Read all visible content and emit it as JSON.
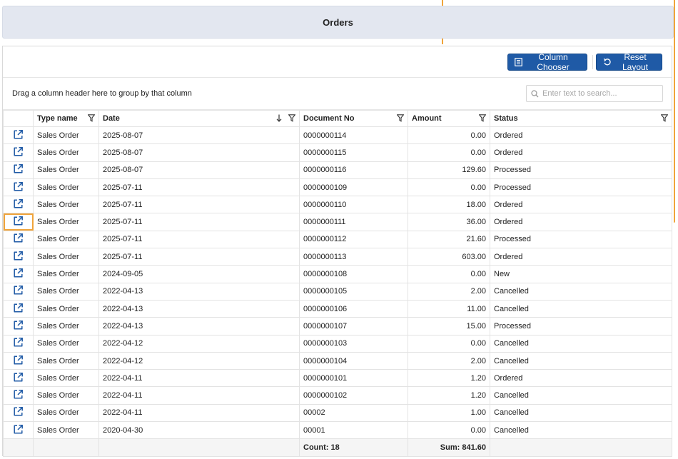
{
  "header": {
    "title": "Orders"
  },
  "toolbar": {
    "column_chooser_label": "Column Chooser",
    "reset_layout_label": "Reset Layout"
  },
  "group_panel": {
    "text": "Drag a column header here to group by that column"
  },
  "search": {
    "placeholder": "Enter text to search..."
  },
  "columns": [
    "Type name",
    "Date",
    "Document No",
    "Amount",
    "Status"
  ],
  "sort": {
    "column": "Date",
    "direction": "descending"
  },
  "rows": [
    [
      "Sales Order",
      "2025-08-07",
      "0000000114",
      "0.00",
      "Ordered"
    ],
    [
      "Sales Order",
      "2025-08-07",
      "0000000115",
      "0.00",
      "Ordered"
    ],
    [
      "Sales Order",
      "2025-08-07",
      "0000000116",
      "129.60",
      "Processed"
    ],
    [
      "Sales Order",
      "2025-07-11",
      "0000000109",
      "0.00",
      "Processed"
    ],
    [
      "Sales Order",
      "2025-07-11",
      "0000000110",
      "18.00",
      "Ordered"
    ],
    [
      "Sales Order",
      "2025-07-11",
      "0000000111",
      "36.00",
      "Ordered"
    ],
    [
      "Sales Order",
      "2025-07-11",
      "0000000112",
      "21.60",
      "Processed"
    ],
    [
      "Sales Order",
      "2025-07-11",
      "0000000113",
      "603.00",
      "Ordered"
    ],
    [
      "Sales Order",
      "2024-09-05",
      "0000000108",
      "0.00",
      "New"
    ],
    [
      "Sales Order",
      "2022-04-13",
      "0000000105",
      "2.00",
      "Cancelled"
    ],
    [
      "Sales Order",
      "2022-04-13",
      "0000000106",
      "11.00",
      "Cancelled"
    ],
    [
      "Sales Order",
      "2022-04-13",
      "0000000107",
      "15.00",
      "Processed"
    ],
    [
      "Sales Order",
      "2022-04-12",
      "0000000103",
      "0.00",
      "Cancelled"
    ],
    [
      "Sales Order",
      "2022-04-12",
      "0000000104",
      "2.00",
      "Cancelled"
    ],
    [
      "Sales Order",
      "2022-04-11",
      "0000000101",
      "1.20",
      "Ordered"
    ],
    [
      "Sales Order",
      "2022-04-11",
      "0000000102",
      "1.20",
      "Cancelled"
    ],
    [
      "Sales Order",
      "2022-04-11",
      "00002",
      "1.00",
      "Cancelled"
    ],
    [
      "Sales Order",
      "2020-04-30",
      "00001",
      "0.00",
      "Cancelled"
    ]
  ],
  "focused_row": 5,
  "summary": {
    "count": "Count: 18",
    "sum": "Sum: 841.60"
  },
  "icons": {
    "row_link": "open-external-icon",
    "filter": "filter-icon",
    "sort": "sort-descending-icon",
    "column_chooser": "column-chooser-icon",
    "reset_layout": "reset-icon",
    "search": "search-icon"
  },
  "colors": {
    "accent": "#1f5aa6",
    "focus": "#f0a43a",
    "header_bar": "#e3e7f0"
  }
}
